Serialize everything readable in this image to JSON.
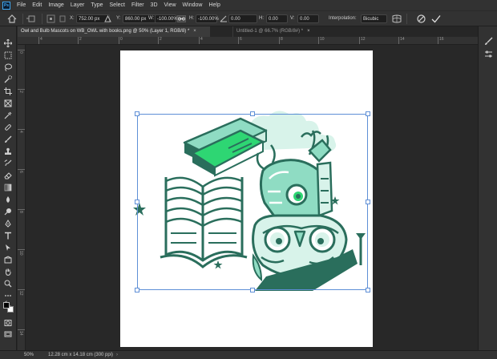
{
  "menu": [
    "File",
    "Edit",
    "Image",
    "Layer",
    "Type",
    "Select",
    "Filter",
    "3D",
    "View",
    "Window",
    "Help"
  ],
  "options": {
    "x_label": "X:",
    "x_value": "752.00 px",
    "y_label": "Y:",
    "y_value": "860.00 px",
    "w_label": "W:",
    "w_value": "-100.00%",
    "h_label": "H:",
    "h_value": "-100.00%",
    "angle_value": "0.00",
    "hskew_label": "H:",
    "hskew_value": "0.00",
    "vskew_label": "V:",
    "vskew_value": "0.00",
    "interp_label": "Interpolation:",
    "interp_value": "Bicubic"
  },
  "tabs": [
    {
      "label": "Owl and Bulb Mascots on WB_OWL with books.png @ 50% (Layer 1, RGB/8) *",
      "close": "×"
    },
    {
      "label": "Untitled-1 @ 66.7% (RGB/8#) *",
      "close": "×"
    }
  ],
  "ruler_h": [
    "4",
    "2",
    "0",
    "2",
    "4",
    "6",
    "8",
    "10",
    "12",
    "14",
    "16"
  ],
  "ruler_v": [
    "0",
    "2",
    "4",
    "6",
    "8",
    "10",
    "12",
    "14"
  ],
  "status": {
    "zoom": "50%",
    "doc_info": "12.28 cm x 14.18 cm (300 ppi)",
    "arrow": "›"
  },
  "colors": {
    "accent": "#3fa9f5",
    "dark_teal": "#2a6e5c",
    "mint": "#8fdcc3",
    "light_mint": "#d8f3ea",
    "green": "#2ed673"
  }
}
